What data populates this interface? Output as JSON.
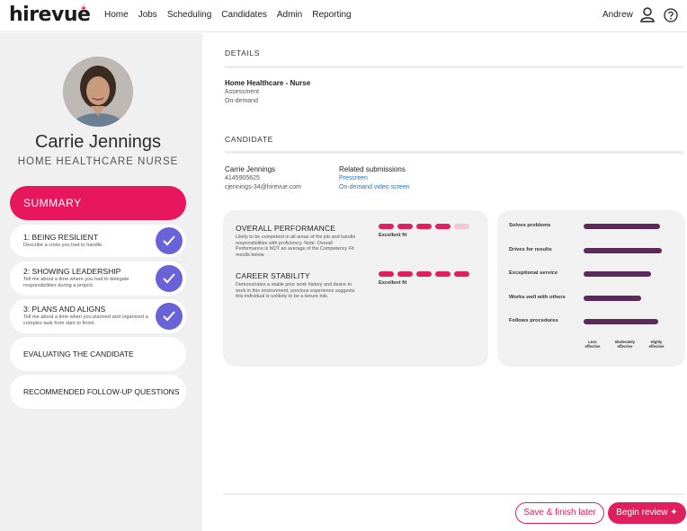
{
  "app": {
    "logo": "hirevue",
    "nav": [
      "Home",
      "Jobs",
      "Scheduling",
      "Candidates",
      "Admin",
      "Reporting"
    ],
    "user": "Andrew",
    "brand_color": "#e0205e",
    "accent_color": "#6a63d8",
    "icons": [
      "user-icon",
      "help-icon"
    ]
  },
  "sidebar": {
    "candidate_name": "Carrie Jennings",
    "candidate_role": "HOME HEALTHCARE NURSE",
    "summary_label": "SUMMARY",
    "questions": [
      {
        "title": "1: BEING RESILIENT",
        "desc": "Describe a crisis you had to handle.",
        "done": true
      },
      {
        "title": "2: SHOWING LEADERSHIP",
        "desc": "Tell me about a time where you had to delegate responsibilities during a project.",
        "done": true
      },
      {
        "title": "3: PLANS AND ALIGNS",
        "desc": "Tell me about a time when you planned and organized a complex task from start to finish.",
        "done": true
      }
    ],
    "links": [
      "EVALUATING THE CANDIDATE",
      "RECOMMENDED FOLLOW-UP QUESTIONS"
    ]
  },
  "details": {
    "heading": "DETAILS",
    "job_title": "Home Healthcare - Nurse",
    "type": "Assessment",
    "mode": "On-demand"
  },
  "candidate": {
    "heading": "CANDIDATE",
    "name": "Carrie Jennings",
    "phone": "4145905625",
    "email": "cjennings-34@hirevue.com",
    "related_heading": "Related submissions",
    "related": [
      "Prescreen",
      "On-demand video screen"
    ]
  },
  "performance": [
    {
      "title": "OVERALL PERFORMANCE",
      "desc": "Likely to be competent in all areas of the job and handle responsibilities with proficiency. Note: Overall Performance is NOT an average of the Competency Fit results below.",
      "score": 4,
      "max": 5,
      "fit": "Excellent fit"
    },
    {
      "title": "CAREER STABILITY",
      "desc": "Demonstrates a stable prior work history and desire to work in this environment; previous experience suggests this individual is unlikely to be a tenure risk.",
      "score": 5,
      "max": 5,
      "fit": "Excellent fit"
    }
  ],
  "competencies": {
    "items": [
      {
        "label": "Solves problems",
        "value": 0.85
      },
      {
        "label": "Drives for results",
        "value": 0.87
      },
      {
        "label": "Exceptional service",
        "value": 0.75
      },
      {
        "label": "Works well with others",
        "value": 0.64
      },
      {
        "label": "Follows procedures",
        "value": 0.83
      }
    ],
    "scale": [
      "Less effective",
      "Moderately effective",
      "Highly effective"
    ]
  },
  "footer": {
    "save_label": "Save & finish later",
    "begin_label": "Begin review ✦"
  }
}
